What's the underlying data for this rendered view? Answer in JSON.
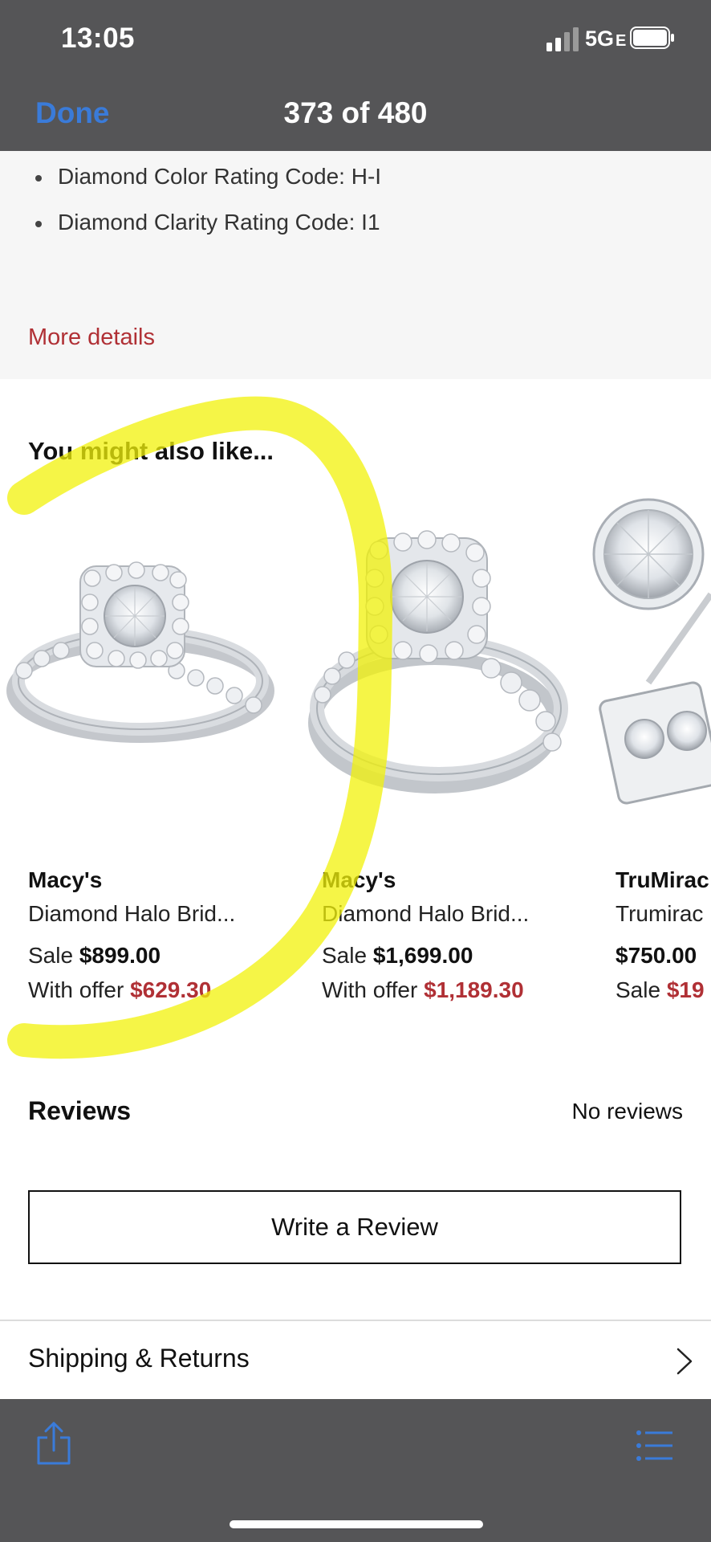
{
  "status_bar": {
    "time": "13:05",
    "network": "5G",
    "network_suffix": "E"
  },
  "nav": {
    "done_label": "Done",
    "counter": "373 of 480"
  },
  "details": {
    "bullets": [
      "Diamond Color Rating Code: H-I",
      "Diamond Clarity Rating Code: I1"
    ],
    "more_link": "More details"
  },
  "recommendations": {
    "title": "You might also like...",
    "products": [
      {
        "brand": "Macy's",
        "name": "Diamond Halo Brid...",
        "price_label": "Sale",
        "price": "$899.00",
        "offer_label": "With offer",
        "offer_price": "$629.30",
        "image": "halo-bridal-ring-set-image"
      },
      {
        "brand": "Macy's",
        "name": "Diamond Halo Brid...",
        "price_label": "Sale",
        "price": "$1,699.00",
        "offer_label": "With offer",
        "offer_price": "$1,189.30",
        "image": "halo-bridal-ring-set-image"
      },
      {
        "brand": "TruMirac",
        "name": "Trumirac",
        "price_label": "",
        "price": "$750.00",
        "offer_label": "Sale",
        "offer_price": "$19",
        "image": "stud-earring-image"
      }
    ]
  },
  "reviews": {
    "title": "Reviews",
    "count_text": "No reviews",
    "write_button": "Write a Review"
  },
  "shipping": {
    "label": "Shipping & Returns"
  },
  "toolbar": {
    "share_icon": "share-icon",
    "list_icon": "list-icon"
  },
  "colors": {
    "bar_bg": "#555557",
    "accent_blue": "#3a7bd9",
    "sale_red": "#b03035",
    "highlight": "#f2f20a"
  }
}
